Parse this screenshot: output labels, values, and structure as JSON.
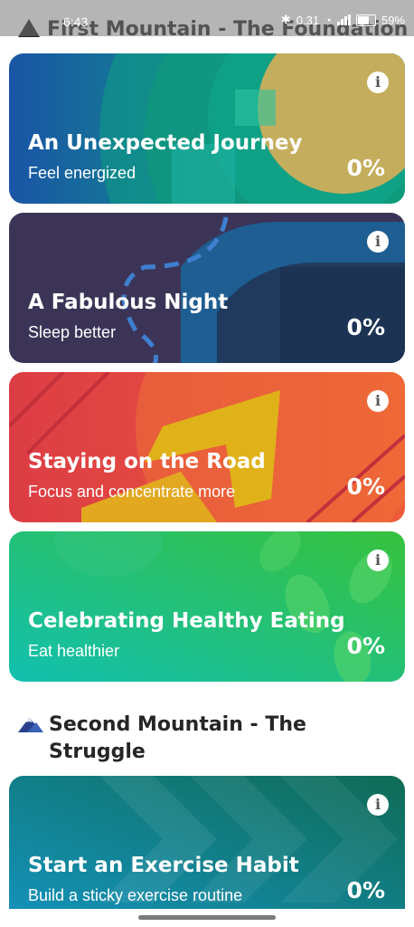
{
  "status_bar": {
    "time": "6:43",
    "network_speed": "0.31",
    "battery": "59%"
  },
  "sections": [
    {
      "title": "First Mountain - The Foundation"
    },
    {
      "title": "Second Mountain - The Struggle"
    }
  ],
  "cards": [
    {
      "title": "An Unexpected Journey",
      "subtitle": "Feel energized",
      "percent": "0%",
      "info_icon": "i"
    },
    {
      "title": "A Fabulous Night",
      "subtitle": "Sleep better",
      "percent": "0%",
      "info_icon": "i"
    },
    {
      "title": "Staying on the Road",
      "subtitle": "Focus and concentrate more",
      "percent": "0%",
      "info_icon": "i"
    },
    {
      "title": "Celebrating Healthy Eating",
      "subtitle": "Eat healthier",
      "percent": "0%",
      "info_icon": "i"
    },
    {
      "title": "Start an Exercise Habit",
      "subtitle": "Build a sticky exercise routine",
      "percent": "0%",
      "info_icon": "i"
    }
  ],
  "colors": {
    "journey": [
      "#1a5fa8",
      "#12a38a",
      "#c9a956"
    ],
    "night": [
      "#3b3357",
      "#1d5e8f"
    ],
    "road": [
      "#e04242",
      "#f0a020"
    ],
    "eating": [
      "#1fb5a3",
      "#2bbf4e"
    ],
    "exercise": [
      "#138fb8",
      "#126a58"
    ]
  }
}
